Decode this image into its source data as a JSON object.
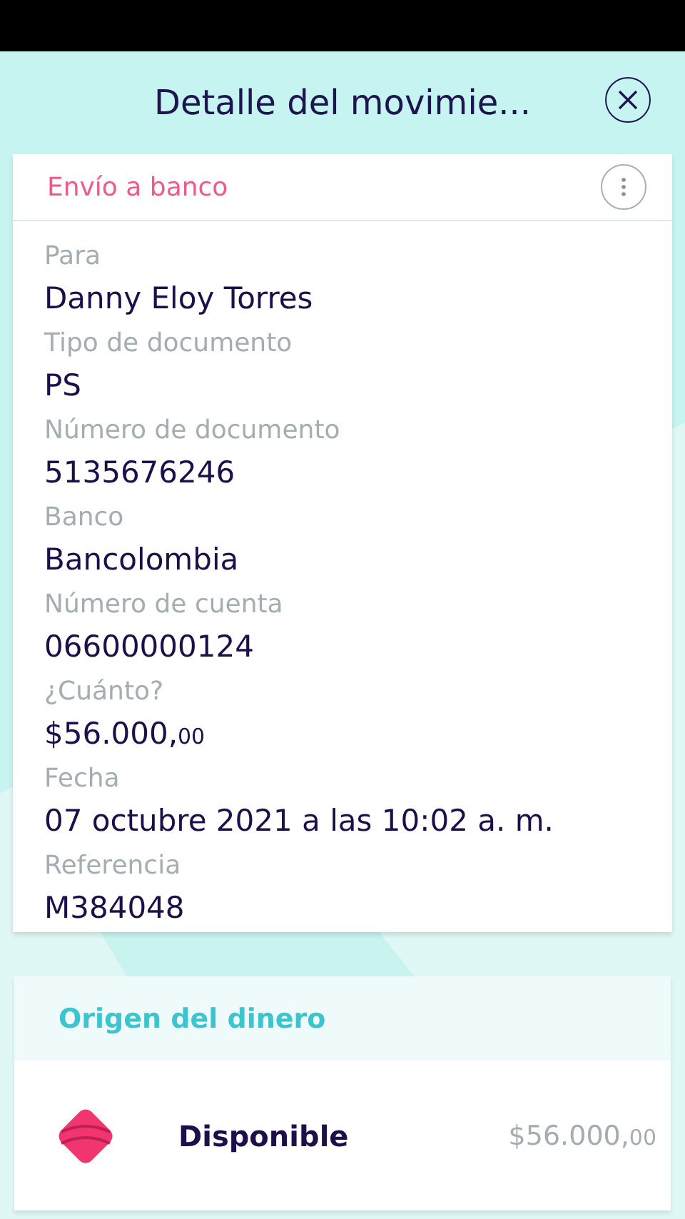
{
  "header": {
    "title": "Detalle del movimie..."
  },
  "detail_card": {
    "title": "Envío a banco",
    "fields": [
      {
        "label": "Para",
        "value": "Danny Eloy Torres"
      },
      {
        "label": "Tipo de documento",
        "value": "PS"
      },
      {
        "label": "Número de documento",
        "value": "5135676246"
      },
      {
        "label": "Banco",
        "value": "Bancolombia"
      },
      {
        "label": "Número de cuenta",
        "value": "06600000124"
      },
      {
        "label": "¿Cuánto?",
        "value": "$56.000,",
        "cents": "00"
      },
      {
        "label": "Fecha",
        "value": "07 octubre 2021 a las 10:02 a. m."
      },
      {
        "label": "Referencia",
        "value": "M384048"
      }
    ]
  },
  "source_card": {
    "title": "Origen del dinero",
    "items": [
      {
        "name": "Disponible",
        "amount": "$56.000,",
        "cents": "00"
      }
    ]
  }
}
